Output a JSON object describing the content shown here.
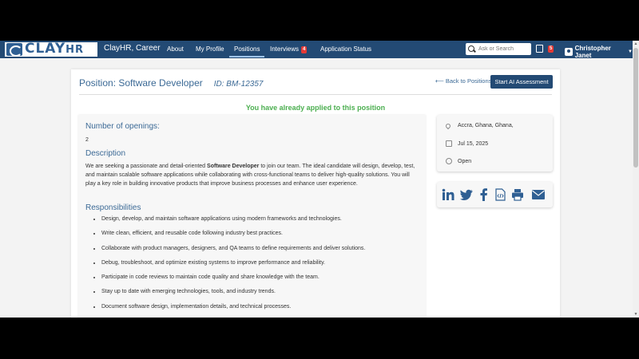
{
  "nav": {
    "logo": "CLAY",
    "logo_suffix": "HR",
    "brand": "ClayHR, Career",
    "links": [
      "About",
      "My Profile",
      "Positions",
      "Interviews",
      "Application Status"
    ],
    "interviews_badge": "4",
    "search_placeholder": "Ask or Search",
    "bag_badge": "5",
    "user_name": "Christopher Janet",
    "accent": "#234a74"
  },
  "page": {
    "title": "Position: Software Developer",
    "job_id": "ID: BM-12357",
    "back_link": "Back to Positions",
    "ai_button": "Start AI Assessment",
    "applied_message": "You have already applied to this position"
  },
  "details": {
    "openings_label": "Number of openings:",
    "openings_value": "2",
    "description_label": "Description",
    "description_pre": "We are seeking a passionate and detail-oriented ",
    "description_bold": "Software Developer",
    "description_post": " to join our team. The ideal candidate will design, develop, test, and maintain scalable software applications while collaborating with cross-functional teams to deliver high-quality solutions. You will play a key role in building innovative products that improve business processes and enhance user experience.",
    "responsibilities_label": "Responsibilities",
    "responsibilities": [
      "Design, develop, and maintain software applications using modern frameworks and technologies.",
      "Write clean, efficient, and reusable code following industry best practices.",
      "Collaborate with product managers, designers, and QA teams to define requirements and deliver solutions.",
      "Debug, troubleshoot, and optimize existing systems to improve performance and reliability.",
      "Participate in code reviews to maintain code quality and share knowledge with the team.",
      "Stay up to date with emerging technologies, tools, and industry trends.",
      "Document software design, implementation details, and technical processes."
    ]
  },
  "info": {
    "location": "Accra, Ghana, Ghana,",
    "date": "Jul 15, 2025",
    "status": "Open"
  },
  "share": {
    "icons": [
      "linkedin-icon",
      "twitter-icon",
      "facebook-icon",
      "embed-code-icon",
      "print-icon",
      "email-icon"
    ],
    "color": "#2f5f93"
  }
}
